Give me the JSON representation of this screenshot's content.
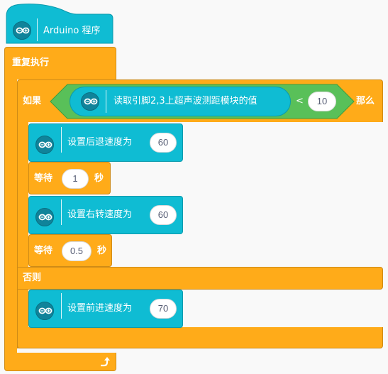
{
  "hat": {
    "label": "Arduino 程序",
    "icon": "arduino-icon"
  },
  "forever": {
    "label": "重复执行"
  },
  "if_block": {
    "label": "如果",
    "then_label": "那么",
    "else_label": "否则",
    "condition": {
      "sensor_label": "读取引脚2,3上超声波测距模块的值",
      "operator": "<",
      "value": "10"
    }
  },
  "then_blocks": [
    {
      "label": "设置后退速度为",
      "value": "60"
    },
    {
      "wait_label": "等待",
      "value": "1",
      "unit": "秒"
    },
    {
      "label": "设置右转速度为",
      "value": "60"
    },
    {
      "wait_label": "等待",
      "value": "0.5",
      "unit": "秒"
    }
  ],
  "else_blocks": [
    {
      "label": "设置前进速度为",
      "value": "70"
    }
  ],
  "colors": {
    "control": "#ffab19",
    "arduino": "#0fbcd3",
    "operator": "#59c059",
    "icon_bg": "#10839a"
  },
  "loop_arrow_icon": "loop-arrow-icon"
}
